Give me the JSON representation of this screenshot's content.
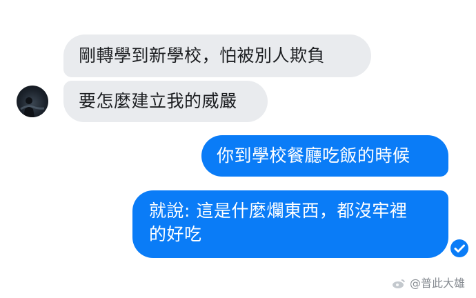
{
  "messages": {
    "incoming": [
      {
        "text": "剛轉學到新學校，怕被別人欺負"
      },
      {
        "text": "要怎麼建立我的威嚴"
      }
    ],
    "outgoing": [
      {
        "text": "你到學校餐廳吃飯的時候"
      },
      {
        "lines": [
          "就說: 這是什麼爛東西，都沒牢裡",
          "的好吃"
        ]
      }
    ]
  },
  "status": {
    "read_receipt_icon": "check-circle-icon"
  },
  "watermark": {
    "text": "@普此大雄",
    "icon": "weibo-icon"
  },
  "colors": {
    "incoming_bubble": "#e9ebee",
    "outgoing_bubble": "#0a7cf7"
  }
}
